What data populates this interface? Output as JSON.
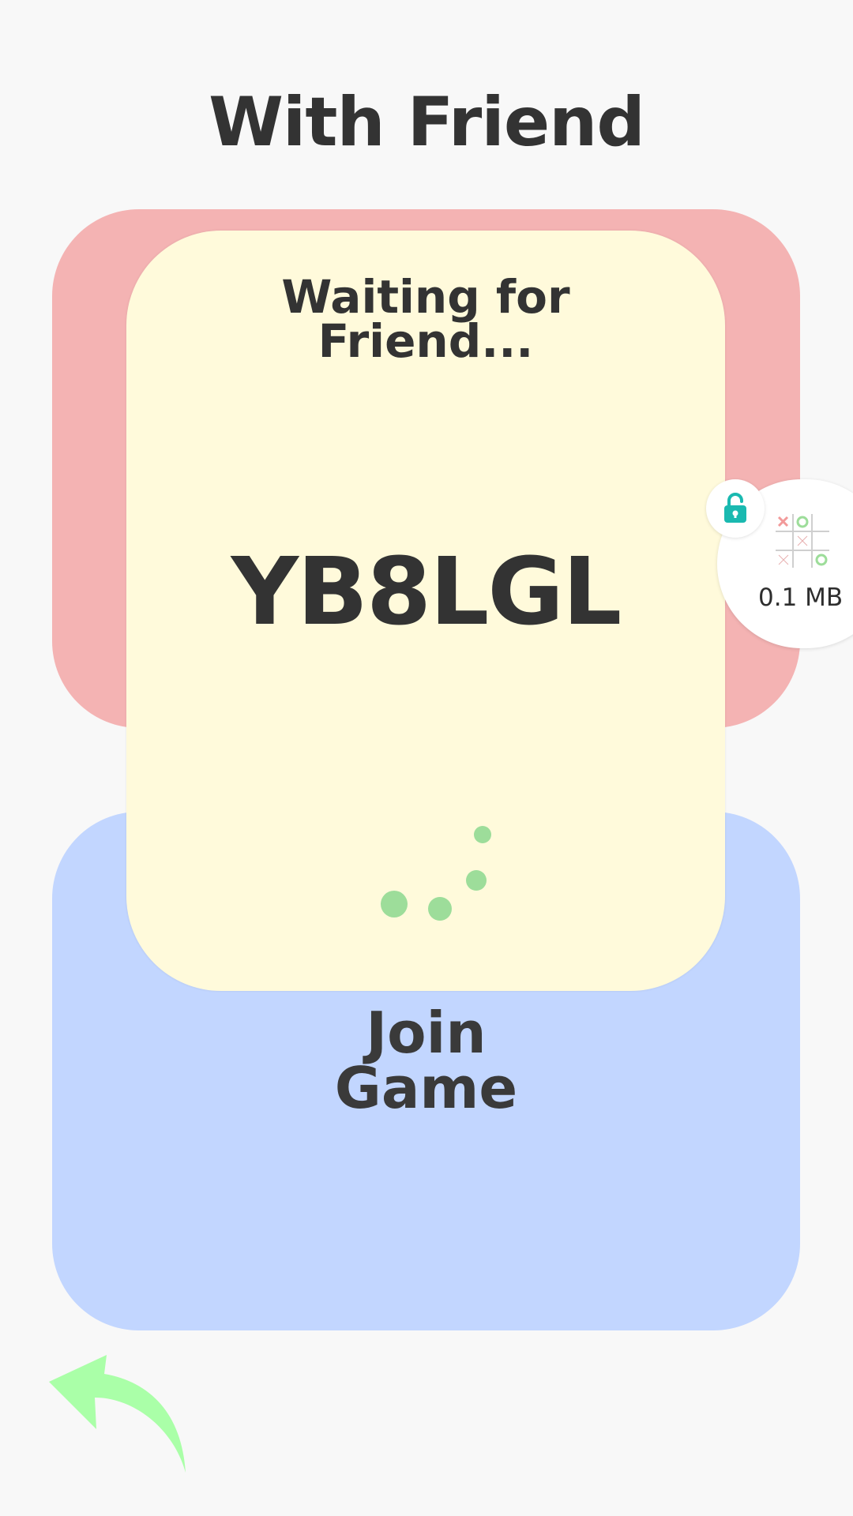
{
  "header": {
    "title": "With Friend"
  },
  "create_card": {
    "color": "#f4b3b3"
  },
  "waiting_card": {
    "title_line1": "Waiting for",
    "title_line2": "Friend...",
    "room_code": "YB8LGL",
    "spinner_color": "#9ddd9a",
    "background": "#fffadb"
  },
  "join_card": {
    "label_line1": "Join",
    "label_line2": "Game",
    "color": "#c2d6ff"
  },
  "floating_bubble": {
    "lock_icon": "unlock-icon",
    "lock_color": "#1ab9b0",
    "thumbnail_icon": "tic-tac-toe-icon",
    "size_text": "0.1 MB"
  },
  "navigation": {
    "back_icon": "back-arrow-icon",
    "back_color": "#aaffa8"
  }
}
